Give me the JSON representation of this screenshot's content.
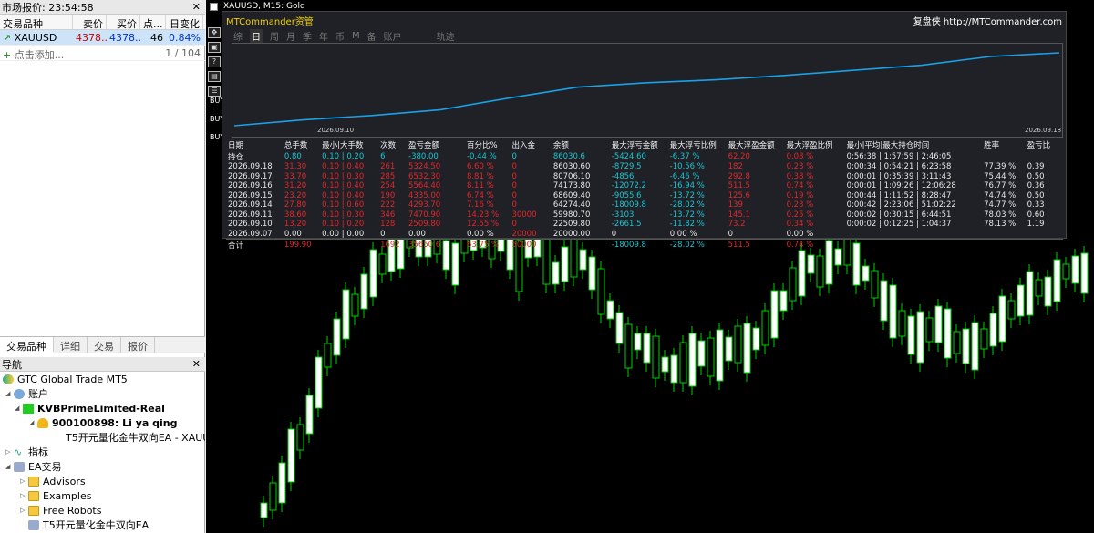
{
  "market": {
    "title": "市场报价: 23:54:58",
    "headers": [
      "交易品种",
      "卖价",
      "买价",
      "点...",
      "日变化"
    ],
    "row": {
      "symbol": "XAUUSD",
      "bid": "4378....",
      "ask": "4378....",
      "spread": "46",
      "change": "0.84%"
    },
    "add_label": "点击添加...",
    "count": "1 / 104",
    "tabs": [
      "交易品种",
      "详细",
      "交易",
      "报价"
    ]
  },
  "navigator": {
    "title": "导航",
    "items": [
      {
        "text": "GTC Global Trade MT5",
        "level": 0
      },
      {
        "text": "账户",
        "level": 1
      },
      {
        "text": "KVBPrimeLimited-Real",
        "level": 2
      },
      {
        "text": "900100898: Li ya qing",
        "level": 3
      },
      {
        "text": "T5开元量化金牛双向EA - XAUU",
        "level": 4
      },
      {
        "text": "指标",
        "level": 1
      },
      {
        "text": "EA交易",
        "level": 1
      },
      {
        "text": "Advisors",
        "level": 2
      },
      {
        "text": "Examples",
        "level": 2
      },
      {
        "text": "Free Robots",
        "level": 2
      },
      {
        "text": "T5开元量化金牛双向EA",
        "level": 2
      }
    ]
  },
  "chart": {
    "title": "XAUUSD, M15:  Gold",
    "buy_labels": [
      "BUY",
      "BUY",
      "BUY"
    ]
  },
  "panel": {
    "brand": "MTCommander资管",
    "link": "复盘侠 http://MTCommander.com",
    "tabs": [
      "综",
      "日",
      "周",
      "月",
      "季",
      "年",
      "币",
      "M",
      "备",
      "账户",
      "轨迹"
    ],
    "active_tab": 1,
    "equity_dates": [
      "2026.09.10",
      "2026.09.18"
    ],
    "equity_curve": [
      0.0,
      0.08,
      0.14,
      0.22,
      0.38,
      0.53,
      0.59,
      0.63,
      0.69,
      0.76,
      0.83,
      0.95,
      1.0
    ],
    "headers": [
      "日期",
      "总手数",
      "最小|大手数",
      "次数",
      "盈亏金额",
      "百分比%",
      "出入金",
      "余额",
      "最大浮亏金额",
      "最大浮亏比例",
      "最大浮盈金额",
      "最大浮盈比例",
      "最小|平均|最大持仓时间",
      "胜率",
      "盈亏比"
    ],
    "rows": [
      {
        "c": [
          "持仓",
          "0.80",
          "0.10 | 0.20",
          "6",
          "-380.00",
          "-0.44 %",
          "0",
          "86030.6",
          "-5424.60",
          "-6.37 %",
          "62.20",
          "0.08 %",
          "0:56:38 | 1:57:59 | 2:46:05",
          "",
          ""
        ],
        "style": "hold"
      },
      {
        "c": [
          "2026.09.18",
          "31.30",
          "0.10 | 0.40",
          "261",
          "5324.50",
          "6.60 %",
          "0",
          "86030.60",
          "-8729.5",
          "-10.56 %",
          "182",
          "0.23 %",
          "0:00:34 | 0:54:21 | 6:23:58",
          "77.39 %",
          "0.39"
        ],
        "style": "day"
      },
      {
        "c": [
          "2026.09.17",
          "33.70",
          "0.10 | 0.30",
          "285",
          "6532.30",
          "8.81 %",
          "0",
          "80706.10",
          "-4856",
          "-6.46 %",
          "292.8",
          "0.38 %",
          "0:00:01 | 0:35:39 | 3:11:43",
          "75.44 %",
          "0.50"
        ],
        "style": "day"
      },
      {
        "c": [
          "2026.09.16",
          "31.20",
          "0.10 | 0.40",
          "254",
          "5564.40",
          "8.11 %",
          "0",
          "74173.80",
          "-12072.2",
          "-16.94 %",
          "511.5",
          "0.74 %",
          "0:00:01 | 1:09:26 | 12:06:28",
          "76.77 %",
          "0.36"
        ],
        "style": "day"
      },
      {
        "c": [
          "2026.09.15",
          "23.20",
          "0.10 | 0.40",
          "190",
          "4335.00",
          "6.74 %",
          "0",
          "68609.40",
          "-9055.6",
          "-13.72 %",
          "125.6",
          "0.19 %",
          "0:00:44 | 1:11:52 | 8:28:47",
          "74.74 %",
          "0.50"
        ],
        "style": "day"
      },
      {
        "c": [
          "2026.09.14",
          "27.80",
          "0.10 | 0.60",
          "222",
          "4293.70",
          "7.16 %",
          "0",
          "64274.40",
          "-18009.8",
          "-28.02 %",
          "139",
          "0.23 %",
          "0:00:42 | 2:23:06 | 51:02:22",
          "74.77 %",
          "0.33"
        ],
        "style": "day"
      },
      {
        "c": [
          "2026.09.11",
          "38.60",
          "0.10 | 0.30",
          "346",
          "7470.90",
          "14.23 %",
          "30000",
          "59980.70",
          "-3103",
          "-13.72 %",
          "145.1",
          "0.25 %",
          "0:00:02 | 0:30:15 | 6:44:51",
          "78.03 %",
          "0.60"
        ],
        "style": "day"
      },
      {
        "c": [
          "2026.09.10",
          "13.20",
          "0.10 | 0.20",
          "128",
          "2509.80",
          "12.55 %",
          "0",
          "22509.80",
          "-2661.5",
          "-11.82 %",
          "73.2",
          "0.34 %",
          "0:00:02 | 0:12:25 | 1:04:37",
          "78.13 %",
          "1.19"
        ],
        "style": "day"
      },
      {
        "c": [
          "2026.09.07",
          "0.00",
          "0.00 | 0.00",
          "0",
          "0.00",
          "0.00 %",
          "20000",
          "20000.00",
          "0",
          "0.00 %",
          "0",
          "0.00 %",
          "",
          "",
          ""
        ],
        "style": "zero"
      },
      {
        "c": [
          "合计",
          "199.90",
          "",
          "1692",
          "35650.6",
          "63.75 %",
          "50000",
          "",
          "-18009.8",
          "-28.02 %",
          "511.5",
          "0.74 %",
          "",
          "",
          ""
        ],
        "style": "total"
      }
    ]
  },
  "colors": {
    "up": "#00d000",
    "cyan": "#19c6d3",
    "red": "#e4262b",
    "curve": "#1aa0e6"
  }
}
